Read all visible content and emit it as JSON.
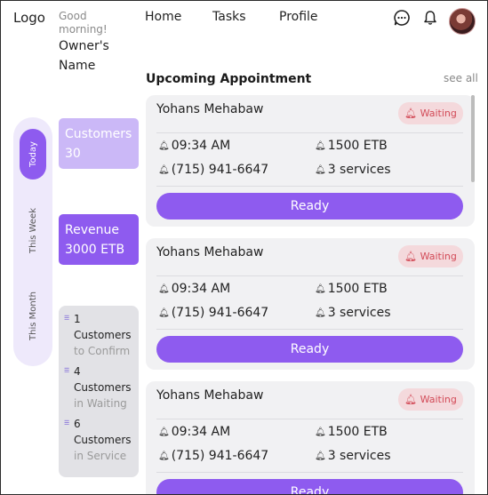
{
  "header": {
    "logo": "Logo",
    "greeting": "Good morning!",
    "owner_name": "Owner's Name",
    "nav": [
      "Home",
      "Tasks",
      "Profile"
    ],
    "icons": [
      "chat-icon",
      "bell-icon"
    ]
  },
  "periods": [
    "Today",
    "This Week",
    "This Month"
  ],
  "stats": {
    "customers_label": "Customers",
    "customers_value": "30",
    "revenue_label": "Revenue",
    "revenue_value": "3000 ETB"
  },
  "summary": [
    {
      "count": "1",
      "label": "Customers",
      "sub": "to Confirm"
    },
    {
      "count": "4",
      "label": "Customers",
      "sub": "in Waiting"
    },
    {
      "count": "6",
      "label": "Customers",
      "sub": "in Service"
    }
  ],
  "appointments": {
    "title": "Upcoming Appointment",
    "see_all": "see all",
    "items": [
      {
        "name": "Yohans Mehabaw",
        "status": "Waiting",
        "time": "09:34 AM",
        "price": "1500 ETB",
        "phone": "(715) 941-6647",
        "services": "3 services",
        "action": "Ready"
      },
      {
        "name": "Yohans Mehabaw",
        "status": "Waiting",
        "time": "09:34 AM",
        "price": "1500 ETB",
        "phone": "(715) 941-6647",
        "services": "3 services",
        "action": "Ready"
      },
      {
        "name": "Yohans Mehabaw",
        "status": "Waiting",
        "time": "09:34 AM",
        "price": "1500 ETB",
        "phone": "(715) 941-6647",
        "services": "3 services",
        "action": "Ready"
      }
    ]
  },
  "colors": {
    "accent": "#8e5bef",
    "accent_light": "#cbb8f7",
    "badge_bg": "#f4d9dc",
    "badge_text": "#d24a57"
  }
}
